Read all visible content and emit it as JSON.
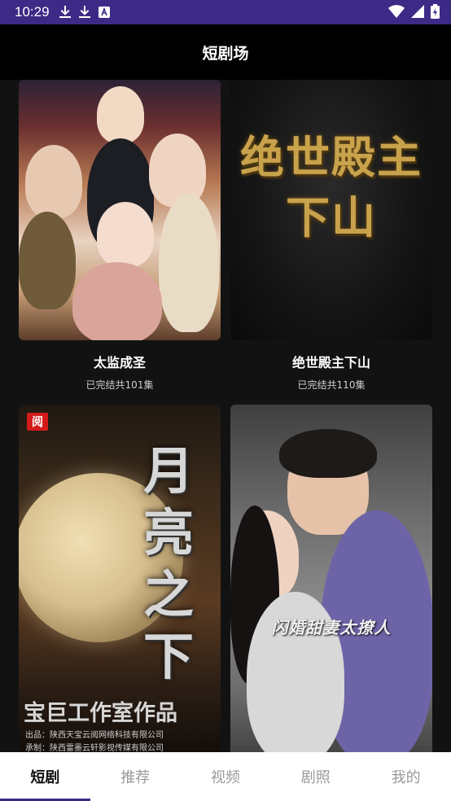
{
  "status": {
    "time": "10:29"
  },
  "header": {
    "title": "短剧场"
  },
  "cards": [
    {
      "title": "太监成圣",
      "subtitle": "已完结共101集"
    },
    {
      "title": "绝世殿主下山",
      "subtitle": "已完结共110集",
      "poster_text": "绝世殿主下山"
    },
    {
      "title": "",
      "subtitle": "",
      "poster_title": "月亮之下",
      "badge": "阅",
      "studio": "宝巨工作室作品",
      "producer": "出品：陕西天宝云阅网络科技有限公司",
      "undertaker": "承制：陕西雷墨云轩影视传媒有限公司"
    },
    {
      "title": "",
      "subtitle": "",
      "poster_caption": "闪婚甜妻太撩人"
    }
  ],
  "nav": [
    {
      "label": "短剧"
    },
    {
      "label": "推荐"
    },
    {
      "label": "视频"
    },
    {
      "label": "剧照"
    },
    {
      "label": "我的"
    }
  ],
  "colors": {
    "statusbar": "#3d2a86",
    "appbar": "#000000",
    "background": "#121212",
    "nav_indicator": "#3d2a86"
  }
}
